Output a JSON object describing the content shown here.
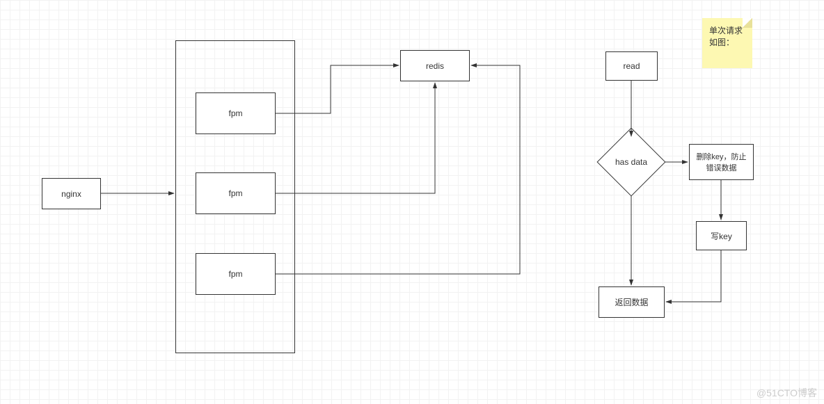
{
  "left": {
    "nginx": "nginx",
    "fpm1": "fpm",
    "fpm2": "fpm",
    "fpm3": "fpm",
    "redis": "redis"
  },
  "right": {
    "read": "read",
    "has_data": "has data",
    "delete_key": "删除key，防止错误数据",
    "write_key": "写key",
    "return_data": "返回数据",
    "sticky_l1": "单次请求",
    "sticky_l2": "如图："
  },
  "watermark": "@51CTO博客",
  "chart_data": {
    "type": "flowchart",
    "diagrams": [
      {
        "name": "architecture",
        "nodes": [
          {
            "id": "nginx",
            "label": "nginx",
            "type": "process"
          },
          {
            "id": "fpm_group",
            "label": "",
            "type": "container",
            "children": [
              "fpm1",
              "fpm2",
              "fpm3"
            ]
          },
          {
            "id": "fpm1",
            "label": "fpm",
            "type": "process"
          },
          {
            "id": "fpm2",
            "label": "fpm",
            "type": "process"
          },
          {
            "id": "fpm3",
            "label": "fpm",
            "type": "process"
          },
          {
            "id": "redis",
            "label": "redis",
            "type": "process"
          }
        ],
        "edges": [
          {
            "from": "nginx",
            "to": "fpm_group"
          },
          {
            "from": "fpm1",
            "to": "redis"
          },
          {
            "from": "fpm2",
            "to": "redis"
          },
          {
            "from": "fpm3",
            "to": "redis"
          }
        ]
      },
      {
        "name": "single-request-flow",
        "note": "单次请求如图：",
        "nodes": [
          {
            "id": "read",
            "label": "read",
            "type": "process"
          },
          {
            "id": "has_data",
            "label": "has data",
            "type": "decision"
          },
          {
            "id": "delete_key",
            "label": "删除key，防止错误数据",
            "type": "process"
          },
          {
            "id": "write_key",
            "label": "写key",
            "type": "process"
          },
          {
            "id": "return_data",
            "label": "返回数据",
            "type": "process"
          }
        ],
        "edges": [
          {
            "from": "read",
            "to": "has_data"
          },
          {
            "from": "has_data",
            "to": "delete_key"
          },
          {
            "from": "delete_key",
            "to": "write_key"
          },
          {
            "from": "write_key",
            "to": "return_data"
          },
          {
            "from": "has_data",
            "to": "return_data"
          }
        ]
      }
    ]
  }
}
